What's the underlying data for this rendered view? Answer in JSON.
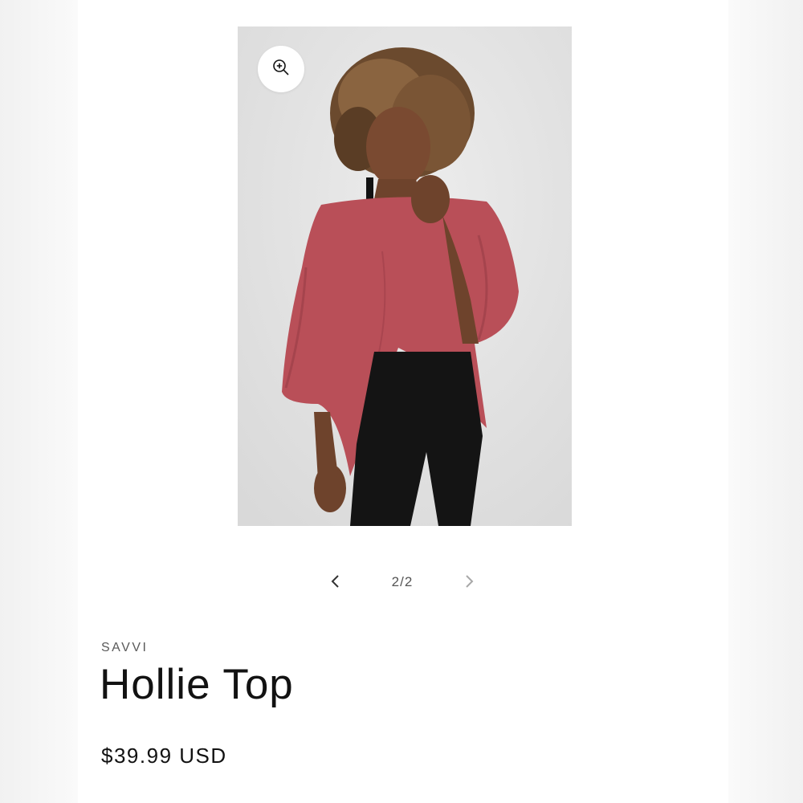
{
  "gallery": {
    "zoom_icon": "zoom-in-icon",
    "prev_icon": "chevron-left-icon",
    "next_icon": "chevron-right-icon",
    "counter": "2/2",
    "current": 2,
    "total": 2
  },
  "product": {
    "vendor": "SAVVI",
    "title": "Hollie Top",
    "price": "$39.99 USD"
  },
  "colors": {
    "page_background": "#ffffff",
    "text": "#121212",
    "muted_text": "#5a5a5a",
    "top_color": "#b94f58",
    "leggings_color": "#141414"
  }
}
